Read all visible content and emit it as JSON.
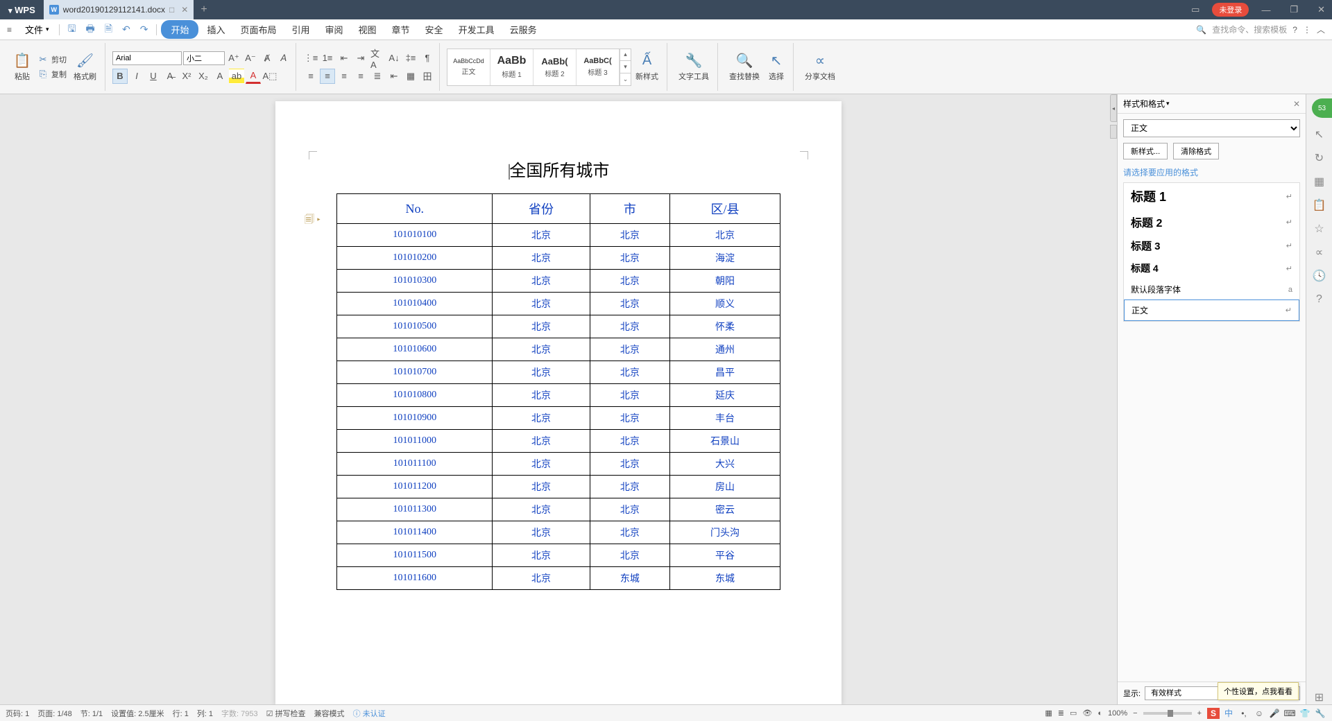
{
  "titlebar": {
    "app_name": "WPS",
    "tab_filename": "word20190129112141.docx",
    "login_badge": "未登录"
  },
  "menubar": {
    "file": "文件",
    "tabs": [
      "开始",
      "插入",
      "页面布局",
      "引用",
      "审阅",
      "视图",
      "章节",
      "安全",
      "开发工具",
      "云服务"
    ],
    "search_placeholder": "查找命令、搜索模板"
  },
  "ribbon": {
    "paste": "粘贴",
    "cut": "剪切",
    "copy": "复制",
    "format_painter": "格式刷",
    "font_name": "Arial",
    "font_size": "小二",
    "styles": [
      {
        "preview": "AaBbCcDd",
        "name": "正文"
      },
      {
        "preview": "AaBb",
        "name": "标题 1"
      },
      {
        "preview": "AaBb(",
        "name": "标题 2"
      },
      {
        "preview": "AaBbC(",
        "name": "标题 3"
      }
    ],
    "new_style": "新样式",
    "text_tools": "文字工具",
    "find_replace": "查找替换",
    "select": "选择",
    "share_doc": "分享文档"
  },
  "document": {
    "title": "全国所有城市",
    "headers": [
      "No.",
      "省份",
      "市",
      "区/县"
    ],
    "rows": [
      [
        "101010100",
        "北京",
        "北京",
        "北京"
      ],
      [
        "101010200",
        "北京",
        "北京",
        "海淀"
      ],
      [
        "101010300",
        "北京",
        "北京",
        "朝阳"
      ],
      [
        "101010400",
        "北京",
        "北京",
        "顺义"
      ],
      [
        "101010500",
        "北京",
        "北京",
        "怀柔"
      ],
      [
        "101010600",
        "北京",
        "北京",
        "通州"
      ],
      [
        "101010700",
        "北京",
        "北京",
        "昌平"
      ],
      [
        "101010800",
        "北京",
        "北京",
        "延庆"
      ],
      [
        "101010900",
        "北京",
        "北京",
        "丰台"
      ],
      [
        "101011000",
        "北京",
        "北京",
        "石景山"
      ],
      [
        "101011100",
        "北京",
        "北京",
        "大兴"
      ],
      [
        "101011200",
        "北京",
        "北京",
        "房山"
      ],
      [
        "101011300",
        "北京",
        "北京",
        "密云"
      ],
      [
        "101011400",
        "北京",
        "北京",
        "门头沟"
      ],
      [
        "101011500",
        "北京",
        "北京",
        "平谷"
      ],
      [
        "101011600",
        "北京",
        "东城",
        "东城"
      ]
    ]
  },
  "sidebar": {
    "title": "样式和格式",
    "current_style": "正文",
    "new_style_btn": "新样式...",
    "clear_format_btn": "清除格式",
    "choose_label": "请选择要应用的格式",
    "styles": [
      "标题 1",
      "标题 2",
      "标题 3",
      "标题 4",
      "默认段落字体",
      "正文"
    ],
    "show_label": "显示:",
    "show_value": "有效样式",
    "tooltip": "个性设置，点我看看"
  },
  "statusbar": {
    "page_no": "页码: 1",
    "page": "页面: 1/48",
    "section": "节: 1/1",
    "position": "设置值: 2.5厘米",
    "line": "行: 1",
    "column": "列: 1",
    "word_count": "字数: 7953",
    "spell": "拼写检查",
    "compat": "兼容模式",
    "auth": "未认证",
    "zoom": "100%"
  }
}
